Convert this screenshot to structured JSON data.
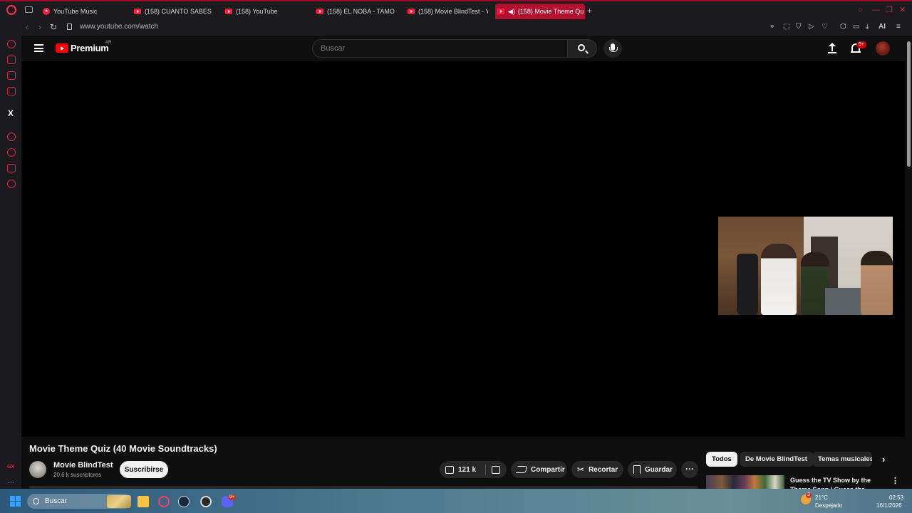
{
  "browser": {
    "tabs": [
      {
        "label": "YouTube Music"
      },
      {
        "label": "(158) CUANTO SABES DE"
      },
      {
        "label": "(158) YouTube"
      },
      {
        "label": "(158) EL NOBA - TAMO CU"
      },
      {
        "label": "(158) Movie BlindTest - Yo"
      },
      {
        "label": "(158) Movie Theme Qu"
      }
    ],
    "new_tab_label": "+",
    "url": "www.youtube.com/watch",
    "ai_label": "AI",
    "accent_color": "#e0223f"
  },
  "youtube": {
    "brand": "Premium",
    "country": "AR",
    "search_placeholder": "Buscar",
    "notification_count": "9+"
  },
  "video": {
    "title": "Movie Theme Quiz (40 Movie Soundtracks)",
    "channel_name": "Movie BlindTest",
    "subscribers": "20.6 k suscriptores",
    "subscribe_label": "Suscribirse",
    "likes": "121 k",
    "share_label": "Compartir",
    "clip_label": "Recortar",
    "save_label": "Guardar",
    "more_label": "···"
  },
  "filters": {
    "chips": [
      {
        "label": "Todos"
      },
      {
        "label": "De Movie BlindTest"
      },
      {
        "label": "Temas musicales"
      }
    ],
    "next_label": "›"
  },
  "recommendation": {
    "title": "Guess the TV Show by the Theme Song | Guess the Them",
    "more_label": "⋮"
  },
  "taskbar": {
    "search_label": "Buscar",
    "weather_badge": "3",
    "temperature": "21°C",
    "condition": "Despejado",
    "time": "02:53",
    "date": "16/1/2026",
    "gx_badge": "9+"
  }
}
